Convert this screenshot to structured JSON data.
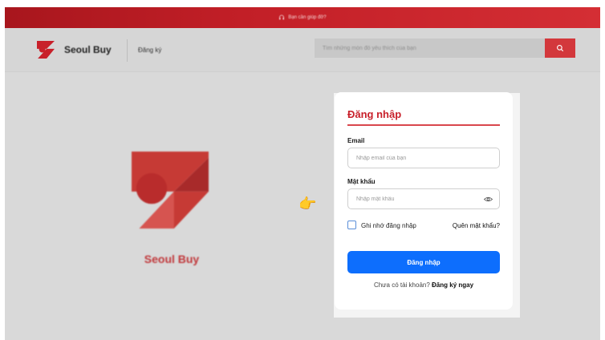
{
  "topbar": {
    "help_text": "Bạn cần giúp đỡ?",
    "help_icon": "headset-icon"
  },
  "header": {
    "brand": "Seoul Buy",
    "signup_link": "Đăng ký",
    "search_placeholder": "Tìm những món đồ yêu thích của bạn",
    "search_icon": "search-icon"
  },
  "hero": {
    "brand": "Seoul Buy"
  },
  "pointer": {
    "glyph": "👉"
  },
  "login": {
    "title": "Đăng nhập",
    "email_label": "Email",
    "email_placeholder": "Nhập email của bạn",
    "password_label": "Mật khẩu",
    "password_placeholder": "Nhập mật khẩu",
    "remember_label": "Ghi nhớ đăng nhập",
    "forgot_link": "Quên mật khẩu?",
    "submit_label": "Đăng nhập",
    "no_account_text": "Chưa có tài khoản?",
    "register_link": "Đăng ký ngay"
  },
  "colors": {
    "brand_red": "#c8202a",
    "primary_blue": "#0d6efd",
    "overlay_gray": "#d9d9d9"
  }
}
